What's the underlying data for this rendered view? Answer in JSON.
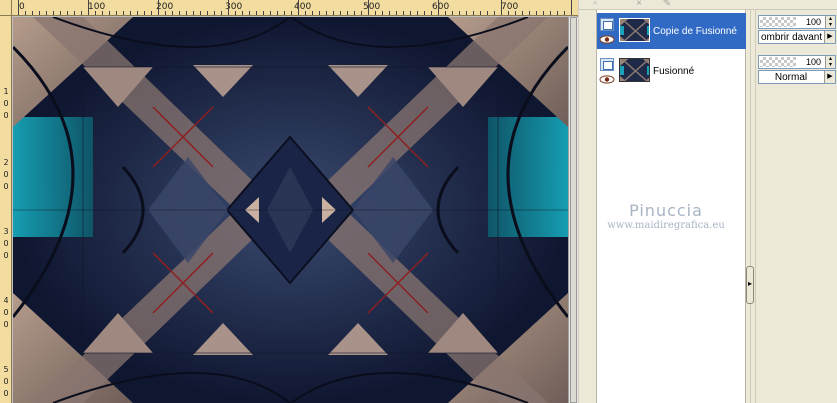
{
  "ruler": {
    "top_labels": [
      "0",
      "100",
      "200",
      "300",
      "400",
      "500",
      "600",
      "700"
    ],
    "left_labels": [
      "1",
      "0",
      "0",
      "2",
      "0",
      "0",
      "3",
      "0",
      "0",
      "4",
      "0",
      "0",
      "5",
      "0",
      "0"
    ]
  },
  "layers": {
    "items": [
      {
        "name": "Copie de Fusionné",
        "selected": true,
        "visible": true
      },
      {
        "name": "Fusionné",
        "selected": false,
        "visible": true
      }
    ]
  },
  "properties": {
    "layer1": {
      "opacity": "100",
      "blend": "ombrir davant"
    },
    "layer2": {
      "opacity": "100",
      "blend": "Normal"
    }
  },
  "watermark": {
    "name": "Pinuccia",
    "url": "www.maidiregrafica.eu"
  },
  "colors": {
    "selection": "#316ac5",
    "ruler": "#f2dca0",
    "panel": "#ece9d8",
    "image_dark": "#1b2440",
    "image_tan": "#9c8678",
    "image_teal": "#1aa3b8"
  },
  "icons": {
    "layer_type": "raster-layer-icon",
    "visibility": "eye-icon",
    "spinner": "spin-arrows-icon",
    "dropdown": "dropdown-arrow-icon",
    "splitter": "splitter-arrow-icon"
  }
}
